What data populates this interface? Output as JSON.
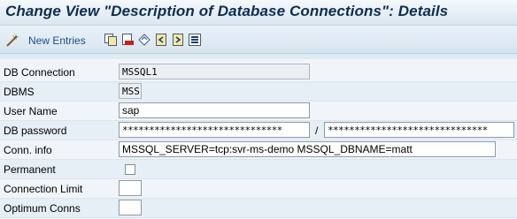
{
  "title": "Change View \"Description of Database Connections\": Details",
  "toolbar": {
    "new_entries_label": "New Entries",
    "icons": [
      "copy-as-icon",
      "delete-icon",
      "undo-change-icon",
      "previous-entry-icon",
      "next-entry-icon",
      "select-all-icon"
    ]
  },
  "fields": {
    "db_connection": {
      "label": "DB Connection",
      "value": "MSSQL1"
    },
    "dbms": {
      "label": "DBMS",
      "value": "MSS"
    },
    "user_name": {
      "label": "User Name",
      "value": "sap"
    },
    "db_password": {
      "label": "DB password",
      "value": "******************************",
      "confirm_value": "******************************",
      "separator": "/"
    },
    "conn_info": {
      "label": "Conn. info",
      "value": "MSSQL_SERVER=tcp:svr-ms-demo MSSQL_DBNAME=matt"
    },
    "permanent": {
      "label": "Permanent",
      "checked": false
    },
    "connection_limit": {
      "label": "Connection Limit",
      "value": ""
    },
    "optimum_conns": {
      "label": "Optimum Conns",
      "value": ""
    }
  }
}
